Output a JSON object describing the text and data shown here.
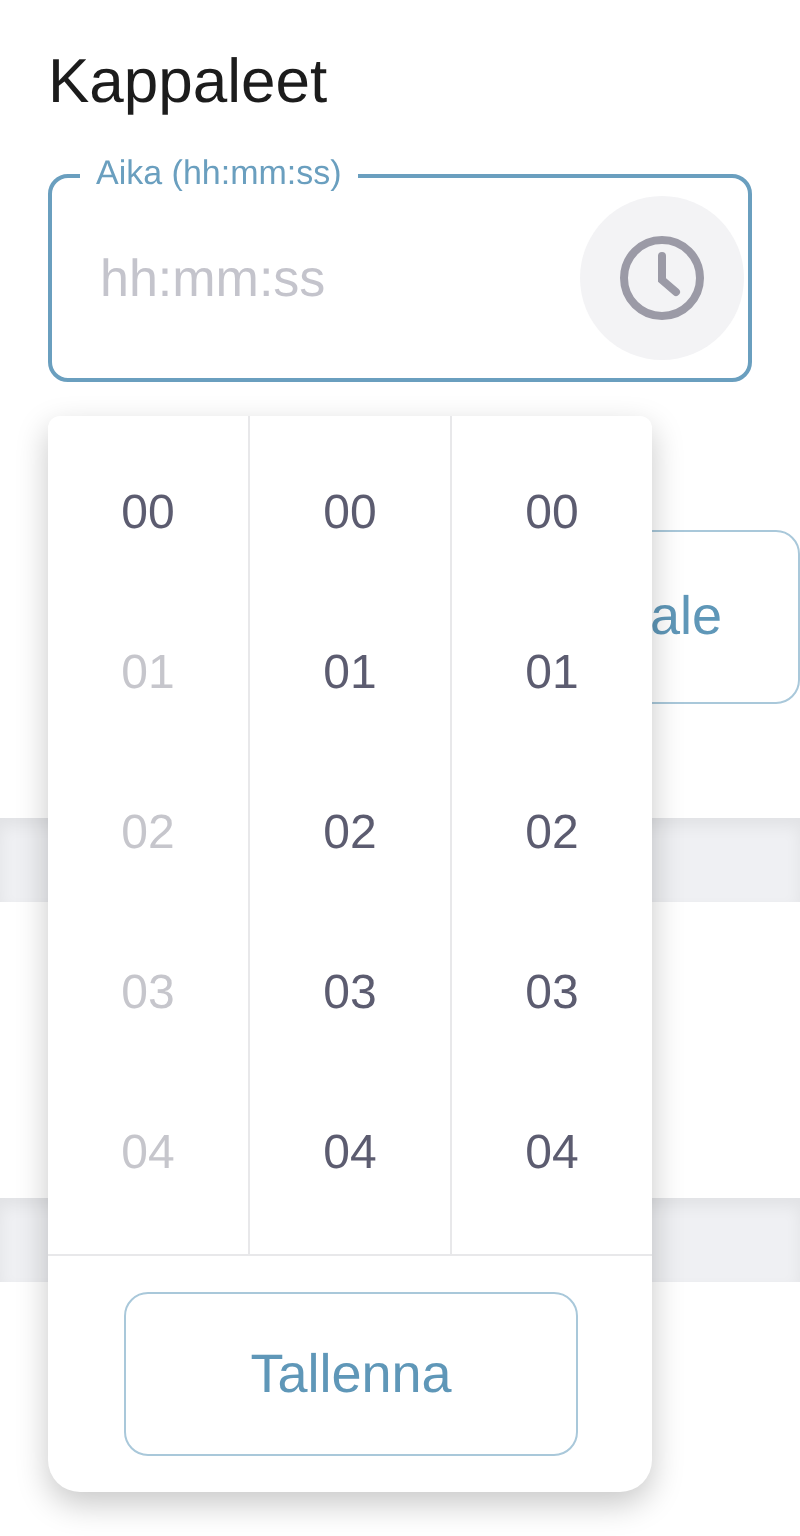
{
  "title": "Kappaleet",
  "time_field": {
    "label": "Aika (hh:mm:ss)",
    "placeholder": "hh:mm:ss"
  },
  "background_button": {
    "label": "ale"
  },
  "picker": {
    "columns": [
      {
        "items": [
          {
            "label": "00",
            "disabled": false
          },
          {
            "label": "01",
            "disabled": true
          },
          {
            "label": "02",
            "disabled": true
          },
          {
            "label": "03",
            "disabled": true
          },
          {
            "label": "04",
            "disabled": true
          }
        ]
      },
      {
        "items": [
          {
            "label": "00",
            "disabled": false
          },
          {
            "label": "01",
            "disabled": false
          },
          {
            "label": "02",
            "disabled": false
          },
          {
            "label": "03",
            "disabled": false
          },
          {
            "label": "04",
            "disabled": false
          }
        ]
      },
      {
        "items": [
          {
            "label": "00",
            "disabled": false
          },
          {
            "label": "01",
            "disabled": false
          },
          {
            "label": "02",
            "disabled": false
          },
          {
            "label": "03",
            "disabled": false
          },
          {
            "label": "04",
            "disabled": false
          }
        ]
      }
    ],
    "save_button": "Tallenna"
  }
}
